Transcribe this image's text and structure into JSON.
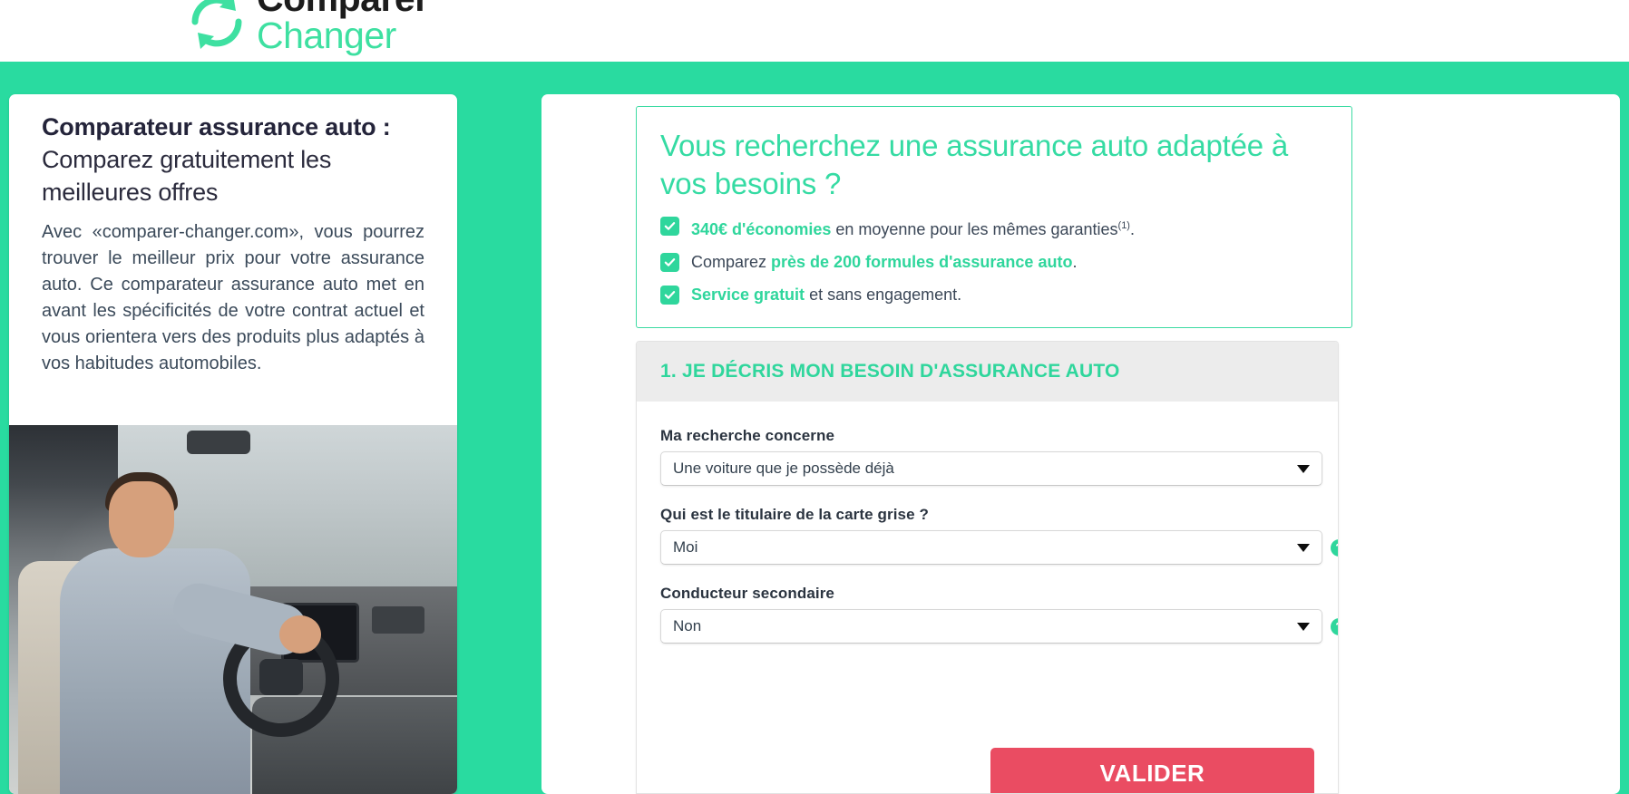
{
  "brand": {
    "logo_top": "Comparer",
    "logo_bottom": "Changer",
    "logo_icon": "circular-arrows-icon",
    "green": "#29dba0",
    "accent_green": "#2fd69c",
    "red": "#ea4c62"
  },
  "left_card": {
    "title_bold": "Comparateur assurance auto :",
    "title_rest": "Comparez gratuitement les meilleures offres",
    "paragraph": "Avec «comparer-changer.com», vous pourrez trouver le meilleur prix pour votre assurance auto. Ce comparateur assurance auto met en avant les spécificités de votre contrat actuel et vous orientera vers des produits plus adaptés à vos habitudes automobiles.",
    "image_alt": "homme souriant au volant d'une voiture"
  },
  "benefits": {
    "heading": "Vous recherchez une assurance auto adaptée à vos besoins ?",
    "items": [
      {
        "strong": "340€ d'économies",
        "rest": " en moyenne pour les mêmes garanties",
        "sup": "(1)",
        "tail": ".",
        "strong_first": true
      },
      {
        "lead": "Comparez ",
        "strong": "près de 200 formules d'assurance auto",
        "tail": ".",
        "strong_first": false
      },
      {
        "strong": "Service gratuit",
        "rest": " et sans engagement.",
        "strong_first": true
      }
    ]
  },
  "form": {
    "step_title": "1. JE DÉCRIS MON BESOIN D'ASSURANCE AUTO",
    "fields": [
      {
        "label": "Ma recherche concerne",
        "value": "Une voiture que je possède déjà",
        "has_help": false
      },
      {
        "label": "Qui est le titulaire de la carte grise ?",
        "value": "Moi",
        "has_help": true
      },
      {
        "label": "Conducteur secondaire",
        "value": "Non",
        "has_help": true
      }
    ],
    "help_glyph": "?",
    "submit_label": "VALIDER"
  }
}
